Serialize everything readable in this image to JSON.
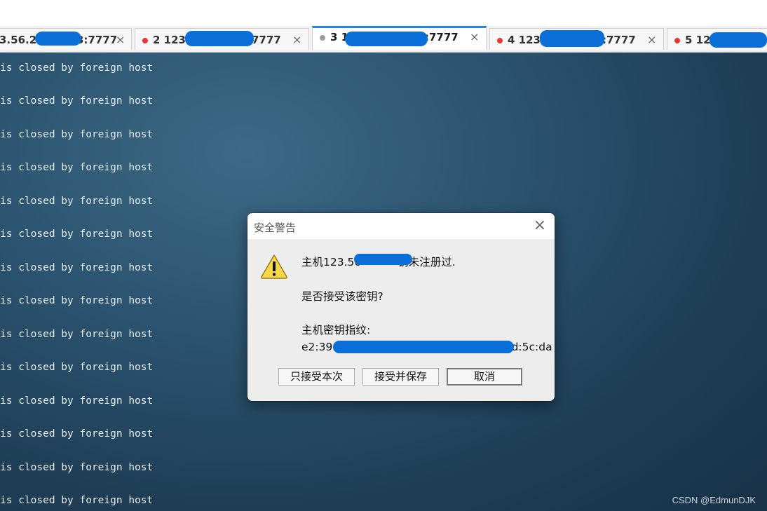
{
  "tabs": [
    {
      "label": "3.56.2",
      "tail": "3:7777",
      "dot": "none",
      "active": false
    },
    {
      "label": "2 123",
      "tail": ":7777",
      "dot": "red",
      "active": false
    },
    {
      "label": "3 12",
      "tail": ":7777",
      "dot": "gray",
      "active": true
    },
    {
      "label": "4 123",
      "tail": ":7777",
      "dot": "red",
      "active": false
    },
    {
      "label": "5 12",
      "tail": "",
      "dot": "red",
      "active": false
    }
  ],
  "close_glyph": "×",
  "terminal": {
    "lines": [
      "is closed by foreign host",
      "is closed by foreign host",
      "is closed by foreign host",
      "is closed by foreign host",
      "is closed by foreign host",
      "is closed by foreign host",
      "is closed by foreign host",
      "is closed by foreign host",
      "is closed by foreign host",
      "is closed by foreign host",
      "is closed by foreign host",
      "is closed by foreign host",
      "is closed by foreign host",
      "is closed by foreign host"
    ]
  },
  "watermark": "CSDN @EdmunDJK",
  "dialog": {
    "title": "安全警告",
    "close": "×",
    "host_prefix": "主机123.56",
    "host_suffix": "钥未注册过.",
    "question": "是否接受该密钥?",
    "fingerprint_label": "主机密钥指纹:",
    "fingerprint_prefix": "e2:39:",
    "fingerprint_suffix": "d:5c:da",
    "buttons": {
      "accept_once": "只接受本次",
      "accept_save": "接受并保存",
      "cancel": "取消"
    }
  },
  "colors": {
    "tab_accent": "#1e88e5",
    "redaction": "#0a6fd8",
    "status_red": "#e53935"
  }
}
